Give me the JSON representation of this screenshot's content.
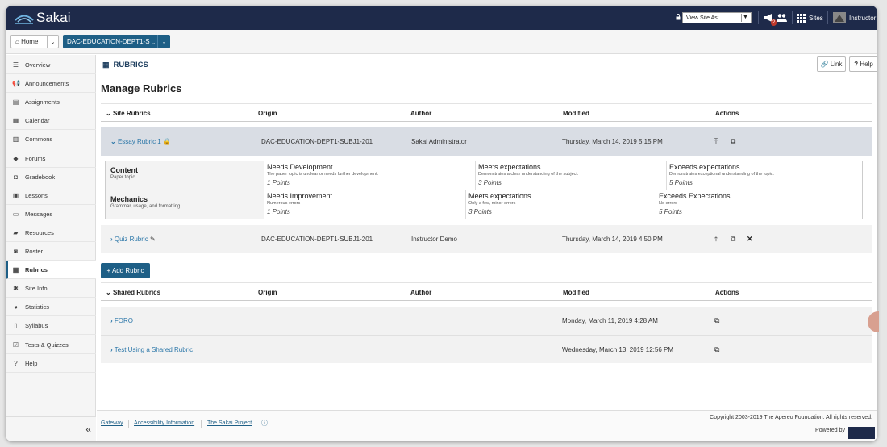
{
  "header": {
    "logo_text": "Sakai",
    "view_site_as": "View Site As:",
    "alerts_count": "2",
    "sites_label": "Sites",
    "user_label": "Instructor"
  },
  "sitebar": {
    "home_label": "Home",
    "site_label": "DAC-EDUCATION-DEPT1-S ..."
  },
  "sidebar": {
    "items": [
      {
        "label": "Overview",
        "icon": "list-icon",
        "glyph": "☰"
      },
      {
        "label": "Announcements",
        "icon": "megaphone-icon",
        "glyph": "📢"
      },
      {
        "label": "Assignments",
        "icon": "file-icon",
        "glyph": "▤"
      },
      {
        "label": "Calendar",
        "icon": "calendar-icon",
        "glyph": "▦"
      },
      {
        "label": "Commons",
        "icon": "commons-icon",
        "glyph": "▥"
      },
      {
        "label": "Forums",
        "icon": "comments-icon",
        "glyph": "◆"
      },
      {
        "label": "Gradebook",
        "icon": "book-icon",
        "glyph": "◘"
      },
      {
        "label": "Lessons",
        "icon": "lessons-icon",
        "glyph": "▣"
      },
      {
        "label": "Messages",
        "icon": "inbox-icon",
        "glyph": "▭"
      },
      {
        "label": "Resources",
        "icon": "folder-icon",
        "glyph": "▰"
      },
      {
        "label": "Roster",
        "icon": "users-icon",
        "glyph": "◙"
      },
      {
        "label": "Rubrics",
        "icon": "table-icon",
        "glyph": "▦"
      },
      {
        "label": "Site Info",
        "icon": "gear-icon",
        "glyph": "✱"
      },
      {
        "label": "Statistics",
        "icon": "pie-chart-icon",
        "glyph": "◕"
      },
      {
        "label": "Syllabus",
        "icon": "map-icon",
        "glyph": "▯"
      },
      {
        "label": "Tests & Quizzes",
        "icon": "checkbox-icon",
        "glyph": "☑"
      },
      {
        "label": "Help",
        "icon": "help-icon",
        "glyph": "?"
      }
    ],
    "collapse_glyph": "«"
  },
  "tool": {
    "title": "RUBRICS",
    "link_label": "Link",
    "help_label": "Help"
  },
  "page_title": "Manage Rubrics",
  "columns": {
    "origin": "Origin",
    "author": "Author",
    "modified": "Modified",
    "actions": "Actions"
  },
  "site_rubrics": {
    "header": "Site Rubrics",
    "rows": [
      {
        "name": "Essay Rubric 1",
        "origin": "DAC-EDUCATION-DEPT1-SUBJ1-201",
        "author": "Sakai Administrator",
        "modified": "Thursday, March 14, 2019 5:15 PM"
      },
      {
        "name": "Quiz Rubric",
        "origin": "DAC-EDUCATION-DEPT1-SUBJ1-201",
        "author": "Instructor Demo",
        "modified": "Thursday, March 14, 2019 4:50 PM"
      }
    ],
    "criteria": [
      {
        "title": "Content",
        "description": "Paper topic",
        "levels": [
          {
            "title": "Needs Development",
            "description": "The paper topic is unclear or needs further development.",
            "points": "1 Points"
          },
          {
            "title": "Meets expectations",
            "description": "Demonstrates a clear understanding of the subject.",
            "points": "3 Points"
          },
          {
            "title": "Exceeds expectations",
            "description": "Demonstrates exceptional understanding of the topic.",
            "points": "5 Points"
          }
        ]
      },
      {
        "title": "Mechanics",
        "description": "Grammar, usage, and formatting",
        "levels": [
          {
            "title": "Needs Improvement",
            "description": "Numerous errors",
            "points": "1 Points"
          },
          {
            "title": "Meets expectations",
            "description": "Only a few, minor errors",
            "points": "3 Points"
          },
          {
            "title": "Exceeds Expectations",
            "description": "No errors",
            "points": "5 Points"
          }
        ]
      }
    ]
  },
  "add_rubric_label": "+ Add Rubric",
  "shared_rubrics": {
    "header": "Shared Rubrics",
    "rows": [
      {
        "name": "FORO",
        "modified": "Monday, March 11, 2019 4:28 AM"
      },
      {
        "name": "Test Using a Shared Rubric",
        "modified": "Wednesday, March 13, 2019 12:56 PM"
      }
    ]
  },
  "footer": {
    "links": [
      "Gateway",
      "Accessibility Information",
      "The Sakai Project"
    ],
    "copyright": "Copyright 2003-2019 The Apereo Foundation. All rights reserved.",
    "powered_by": "Powered by"
  }
}
